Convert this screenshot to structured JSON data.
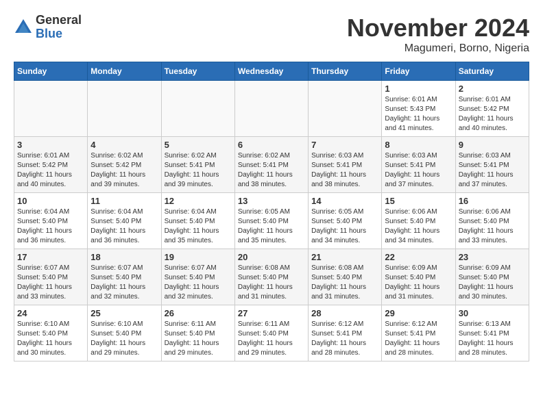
{
  "logo": {
    "general": "General",
    "blue": "Blue"
  },
  "header": {
    "month": "November 2024",
    "location": "Magumeri, Borno, Nigeria"
  },
  "weekdays": [
    "Sunday",
    "Monday",
    "Tuesday",
    "Wednesday",
    "Thursday",
    "Friday",
    "Saturday"
  ],
  "weeks": [
    [
      {
        "day": "",
        "info": ""
      },
      {
        "day": "",
        "info": ""
      },
      {
        "day": "",
        "info": ""
      },
      {
        "day": "",
        "info": ""
      },
      {
        "day": "",
        "info": ""
      },
      {
        "day": "1",
        "info": "Sunrise: 6:01 AM\nSunset: 5:43 PM\nDaylight: 11 hours\nand 41 minutes."
      },
      {
        "day": "2",
        "info": "Sunrise: 6:01 AM\nSunset: 5:42 PM\nDaylight: 11 hours\nand 40 minutes."
      }
    ],
    [
      {
        "day": "3",
        "info": "Sunrise: 6:01 AM\nSunset: 5:42 PM\nDaylight: 11 hours\nand 40 minutes."
      },
      {
        "day": "4",
        "info": "Sunrise: 6:02 AM\nSunset: 5:42 PM\nDaylight: 11 hours\nand 39 minutes."
      },
      {
        "day": "5",
        "info": "Sunrise: 6:02 AM\nSunset: 5:41 PM\nDaylight: 11 hours\nand 39 minutes."
      },
      {
        "day": "6",
        "info": "Sunrise: 6:02 AM\nSunset: 5:41 PM\nDaylight: 11 hours\nand 38 minutes."
      },
      {
        "day": "7",
        "info": "Sunrise: 6:03 AM\nSunset: 5:41 PM\nDaylight: 11 hours\nand 38 minutes."
      },
      {
        "day": "8",
        "info": "Sunrise: 6:03 AM\nSunset: 5:41 PM\nDaylight: 11 hours\nand 37 minutes."
      },
      {
        "day": "9",
        "info": "Sunrise: 6:03 AM\nSunset: 5:41 PM\nDaylight: 11 hours\nand 37 minutes."
      }
    ],
    [
      {
        "day": "10",
        "info": "Sunrise: 6:04 AM\nSunset: 5:40 PM\nDaylight: 11 hours\nand 36 minutes."
      },
      {
        "day": "11",
        "info": "Sunrise: 6:04 AM\nSunset: 5:40 PM\nDaylight: 11 hours\nand 36 minutes."
      },
      {
        "day": "12",
        "info": "Sunrise: 6:04 AM\nSunset: 5:40 PM\nDaylight: 11 hours\nand 35 minutes."
      },
      {
        "day": "13",
        "info": "Sunrise: 6:05 AM\nSunset: 5:40 PM\nDaylight: 11 hours\nand 35 minutes."
      },
      {
        "day": "14",
        "info": "Sunrise: 6:05 AM\nSunset: 5:40 PM\nDaylight: 11 hours\nand 34 minutes."
      },
      {
        "day": "15",
        "info": "Sunrise: 6:06 AM\nSunset: 5:40 PM\nDaylight: 11 hours\nand 34 minutes."
      },
      {
        "day": "16",
        "info": "Sunrise: 6:06 AM\nSunset: 5:40 PM\nDaylight: 11 hours\nand 33 minutes."
      }
    ],
    [
      {
        "day": "17",
        "info": "Sunrise: 6:07 AM\nSunset: 5:40 PM\nDaylight: 11 hours\nand 33 minutes."
      },
      {
        "day": "18",
        "info": "Sunrise: 6:07 AM\nSunset: 5:40 PM\nDaylight: 11 hours\nand 32 minutes."
      },
      {
        "day": "19",
        "info": "Sunrise: 6:07 AM\nSunset: 5:40 PM\nDaylight: 11 hours\nand 32 minutes."
      },
      {
        "day": "20",
        "info": "Sunrise: 6:08 AM\nSunset: 5:40 PM\nDaylight: 11 hours\nand 31 minutes."
      },
      {
        "day": "21",
        "info": "Sunrise: 6:08 AM\nSunset: 5:40 PM\nDaylight: 11 hours\nand 31 minutes."
      },
      {
        "day": "22",
        "info": "Sunrise: 6:09 AM\nSunset: 5:40 PM\nDaylight: 11 hours\nand 31 minutes."
      },
      {
        "day": "23",
        "info": "Sunrise: 6:09 AM\nSunset: 5:40 PM\nDaylight: 11 hours\nand 30 minutes."
      }
    ],
    [
      {
        "day": "24",
        "info": "Sunrise: 6:10 AM\nSunset: 5:40 PM\nDaylight: 11 hours\nand 30 minutes."
      },
      {
        "day": "25",
        "info": "Sunrise: 6:10 AM\nSunset: 5:40 PM\nDaylight: 11 hours\nand 29 minutes."
      },
      {
        "day": "26",
        "info": "Sunrise: 6:11 AM\nSunset: 5:40 PM\nDaylight: 11 hours\nand 29 minutes."
      },
      {
        "day": "27",
        "info": "Sunrise: 6:11 AM\nSunset: 5:40 PM\nDaylight: 11 hours\nand 29 minutes."
      },
      {
        "day": "28",
        "info": "Sunrise: 6:12 AM\nSunset: 5:41 PM\nDaylight: 11 hours\nand 28 minutes."
      },
      {
        "day": "29",
        "info": "Sunrise: 6:12 AM\nSunset: 5:41 PM\nDaylight: 11 hours\nand 28 minutes."
      },
      {
        "day": "30",
        "info": "Sunrise: 6:13 AM\nSunset: 5:41 PM\nDaylight: 11 hours\nand 28 minutes."
      }
    ]
  ]
}
